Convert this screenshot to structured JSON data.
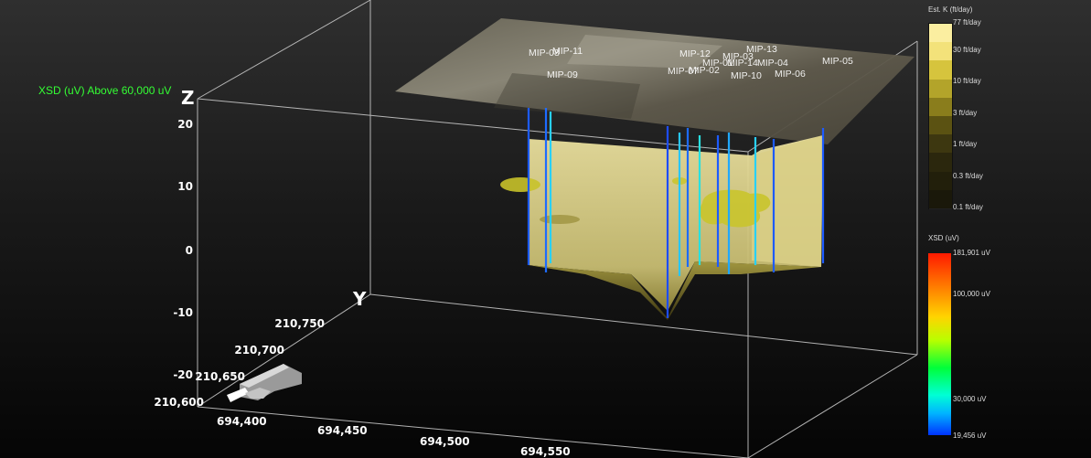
{
  "overlay": {
    "title": "XSD (uV) Above 60,000 uV",
    "title_color": "#34ff34"
  },
  "axes": {
    "z_label": "Z",
    "y_label": "Y",
    "z_ticks": [
      "20",
      "10",
      "0",
      "-10",
      "-20"
    ],
    "y_ticks": [
      "210,750",
      "210,700",
      "210,650",
      "210,600"
    ],
    "x_ticks": [
      "694,400",
      "694,450",
      "694,500",
      "694,550"
    ]
  },
  "wells": [
    "MIP-08",
    "MIP-11",
    "MIP-09",
    "MIP-12",
    "MIP-13",
    "MIP-03",
    "MIP-07",
    "MIP-02",
    "MIP-01",
    "MIP-14",
    "MIP-04",
    "MIP-10",
    "MIP-06",
    "MIP-05"
  ],
  "k_legend": {
    "title": "Est. K (ft/day)",
    "ticks": [
      "77 ft/day",
      "30 ft/day",
      "10 ft/day",
      "3 ft/day",
      "1 ft/day",
      "0.3 ft/day",
      "0.1 ft/day"
    ],
    "colors": [
      "#fbeea0",
      "#f3e27a",
      "#d6c43d",
      "#b3a42a",
      "#8a7d1c",
      "#5b5212",
      "#3d3710",
      "#2b270d",
      "#221f0b",
      "#1a180a"
    ]
  },
  "xsd_legend": {
    "title": "XSD (uV)",
    "ticks": [
      "181,901 uV",
      "100,000 uV",
      "30,000 uV",
      "19,456 uV"
    ]
  }
}
